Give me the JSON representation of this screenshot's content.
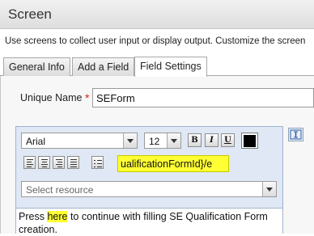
{
  "header": {
    "title": "Screen"
  },
  "description": "Use screens to collect user input or display output. Customize the screen",
  "tabs": [
    {
      "label": "General Info"
    },
    {
      "label": "Add a Field"
    },
    {
      "label": "Field Settings",
      "active": true
    }
  ],
  "unique_name": {
    "label": "Unique Name",
    "required_mark": "*",
    "value": "SEForm"
  },
  "editor": {
    "font_family": "Arial",
    "font_size": "12",
    "bold": "B",
    "italic": "I",
    "underline": "U",
    "text_color": "#000000",
    "merge_field_value": "ualificationFormId}/e",
    "resource_placeholder": "Select resource",
    "body": {
      "before": "Press ",
      "link": "here",
      "after": " to continue with filling SE Qualification Form creation."
    }
  },
  "colors": {
    "highlight": "#ffff33",
    "required": "#d6201b",
    "editor_border": "#9fb4cf"
  }
}
